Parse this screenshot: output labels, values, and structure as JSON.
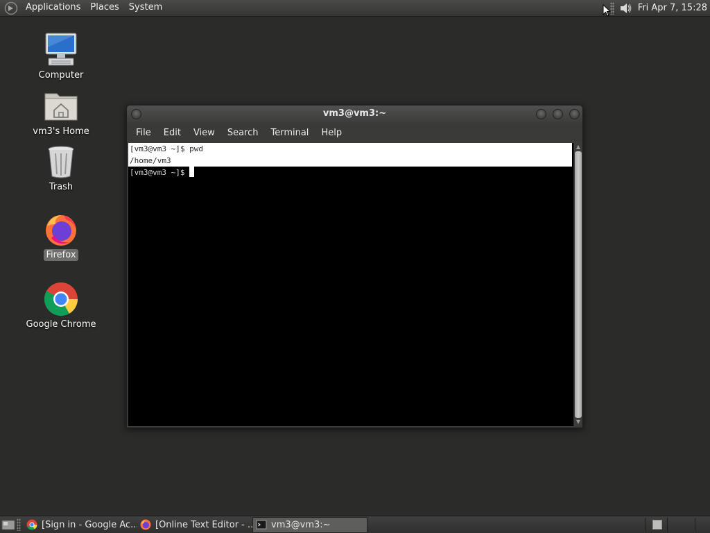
{
  "top_panel": {
    "menus": [
      "Applications",
      "Places",
      "System"
    ],
    "clock": "Fri Apr  7, 15:28",
    "icons": {
      "logo": "gnome-foot-icon",
      "volume": "volume-icon"
    }
  },
  "desktop": {
    "icons": [
      {
        "label": "Computer",
        "icon": "computer-icon"
      },
      {
        "label": "vm3's Home",
        "icon": "home-folder-icon"
      },
      {
        "label": "Trash",
        "icon": "trash-icon"
      },
      {
        "label": "Firefox",
        "icon": "firefox-icon",
        "selected": true
      },
      {
        "label": "Google Chrome",
        "icon": "chrome-icon"
      }
    ]
  },
  "terminal": {
    "title": "vm3@vm3:~",
    "menu": [
      "File",
      "Edit",
      "View",
      "Search",
      "Terminal",
      "Help"
    ],
    "lines": [
      {
        "text": "[vm3@vm3 ~]$ pwd",
        "selected": true
      },
      {
        "text": "/home/vm3",
        "selected": true
      },
      {
        "text": "[vm3@vm3 ~]$ ",
        "selected": false,
        "cursor": true
      }
    ]
  },
  "taskbar": {
    "tasks": [
      {
        "label": "[Sign in - Google Ac...",
        "icon": "chrome-icon",
        "active": false
      },
      {
        "label": "[Online Text Editor - ...",
        "icon": "firefox-icon",
        "active": false
      },
      {
        "label": "vm3@vm3:~",
        "icon": "terminal-icon",
        "active": true
      }
    ]
  },
  "colors": {
    "desktop_bg": "#2b2b29",
    "terminal_bg": "#000000",
    "selection_bg": "#ffffff"
  }
}
